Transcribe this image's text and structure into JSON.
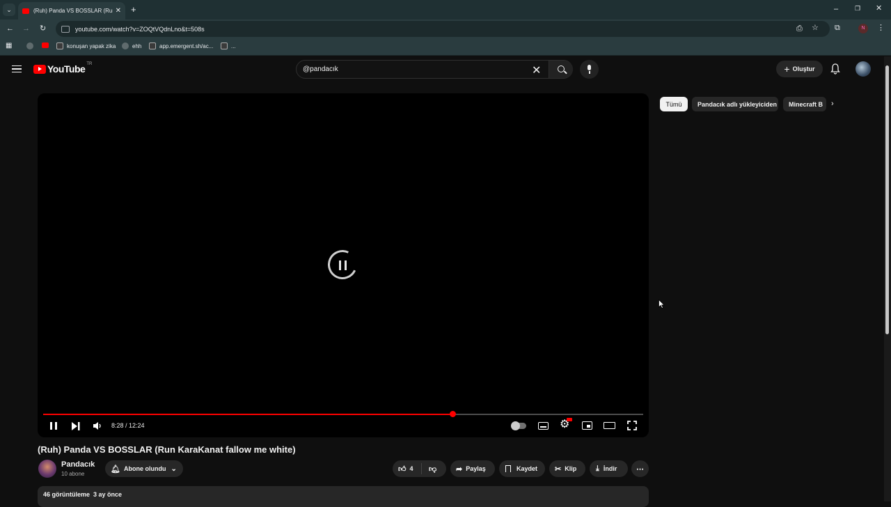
{
  "browser": {
    "tab_title": "(Ruh) Panda VS BOSSLAR (Run",
    "url": "youtube.com/watch?v=ZOQtVQdnLno&t=508s",
    "bookmarks": [
      "konuşan yapak zika",
      "ehh",
      "app.emergent.sh/ac...",
      "..."
    ]
  },
  "header": {
    "logo_text": "YouTube",
    "region": "TR",
    "search_value": "@pandacık",
    "create_label": "Oluştur"
  },
  "player": {
    "current_time": "8:28",
    "duration": "12:24",
    "time_display": "8:28 / 12:24",
    "progress": 0.682,
    "accent": "#ff0000"
  },
  "video": {
    "title": "(Ruh) Panda VS BOSSLAR (Run KaraKanat fallow me white)",
    "channel": "Pandacık",
    "subscribers": "10 abone",
    "subscribe_label": "Abone olundu",
    "likes": "4",
    "share_label": "Paylaş",
    "save_label": "Kaydet",
    "clip_label": "Klip",
    "download_label": "İndir",
    "meta": "46 görüntüleme  3 ay önce"
  },
  "chips": [
    "Tümü",
    "Pandacık adlı yükleyiciden",
    "Minecraft B"
  ]
}
